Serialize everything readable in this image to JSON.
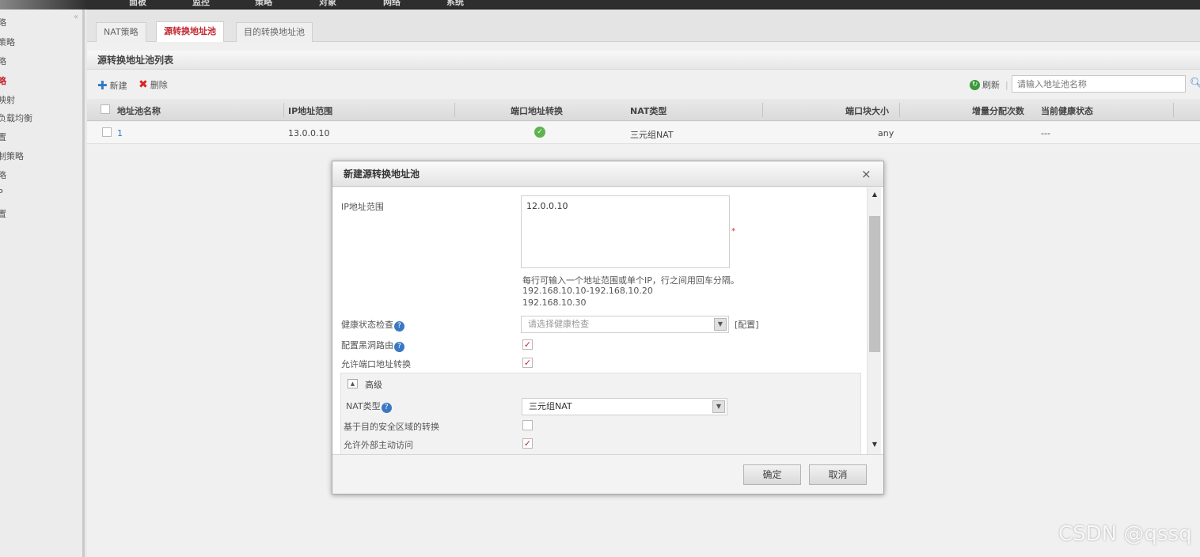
{
  "topnav": {
    "items": [
      "面板",
      "监控",
      "策略",
      "对象",
      "网络",
      "系统"
    ]
  },
  "sidebar": {
    "items": [
      {
        "label": "略"
      },
      {
        "label": "策略"
      },
      {
        "label": "略"
      },
      {
        "label": "略",
        "active": true
      },
      {
        "label": "映射"
      },
      {
        "label": "负载均衡"
      },
      {
        "label": "置"
      },
      {
        "label": "制策略"
      },
      {
        "label": "略"
      },
      {
        "label": "P"
      },
      {
        "label": "置"
      }
    ]
  },
  "tabs": [
    {
      "label": "NAT策略"
    },
    {
      "label": "源转换地址池",
      "active": true
    },
    {
      "label": "目的转换地址池"
    }
  ],
  "section_title": "源转换地址池列表",
  "toolbar": {
    "new_label": "新建",
    "delete_label": "删除",
    "refresh_label": "刷新",
    "separator": "|",
    "search_placeholder": "请输入地址池名称"
  },
  "table": {
    "headers": {
      "name": "地址池名称",
      "ip_range": "IP地址范围",
      "port_nat": "端口地址转换",
      "nat_type": "NAT类型",
      "port_block": "端口块大小",
      "incr_count": "增量分配次数",
      "health": "当前健康状态"
    },
    "rows": [
      {
        "name": "1",
        "ip_range": "13.0.0.10",
        "port_nat": true,
        "nat_type": "三元组NAT",
        "port_block": "any",
        "incr_count": "",
        "health": "---"
      }
    ]
  },
  "dialog": {
    "title": "新建源转换地址池",
    "close": "×",
    "ip_range_label": "IP地址范围",
    "ip_range_value": "12.0.0.10",
    "required_mark": "*",
    "hint_line1": "每行可输入一个地址范围或单个IP，行之间用回车分隔。",
    "hint_line2": "192.168.10.10-192.168.10.20",
    "hint_line3": "192.168.10.30",
    "health_check_label": "健康状态检查",
    "health_check_placeholder": "请选择健康检查",
    "health_check_config": "[配置]",
    "blackhole_label": "配置黑洞路由",
    "blackhole_checked": true,
    "allow_pat_label": "允许端口地址转换",
    "allow_pat_checked": true,
    "advanced_label": "高级",
    "nat_type_label": "NAT类型",
    "nat_type_value": "三元组NAT",
    "zone_conversion_label": "基于目的安全区域的转换",
    "zone_conversion_checked": false,
    "allow_external_label": "允许外部主动访问",
    "allow_external_checked": true,
    "ok_label": "确定",
    "cancel_label": "取消"
  },
  "watermark": "CSDN @qssq"
}
